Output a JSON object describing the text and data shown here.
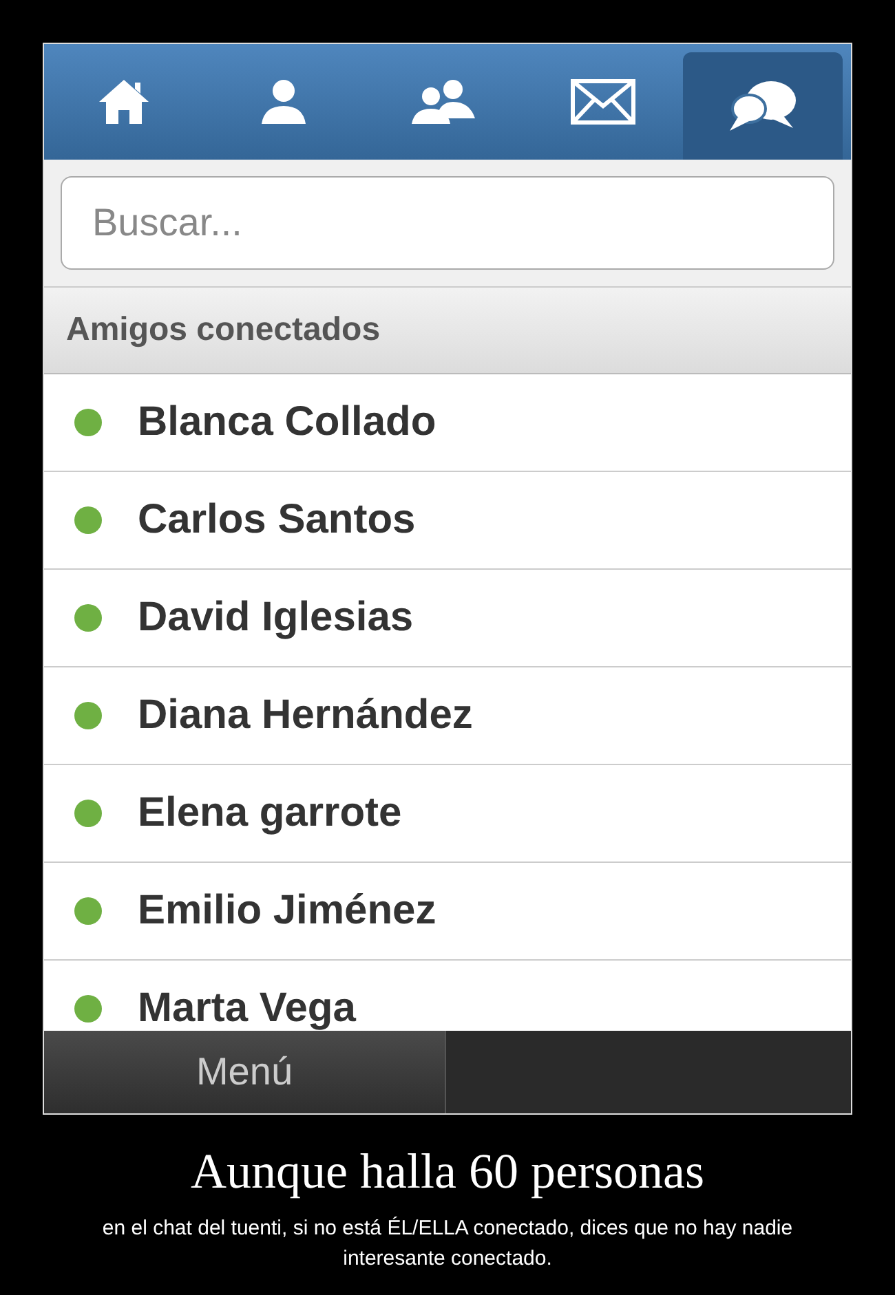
{
  "tabs": [
    {
      "kind": "home",
      "selected": false
    },
    {
      "kind": "person",
      "selected": false
    },
    {
      "kind": "people",
      "selected": false
    },
    {
      "kind": "mail",
      "selected": false
    },
    {
      "kind": "chat",
      "selected": true
    }
  ],
  "search": {
    "placeholder": "Buscar..."
  },
  "section_title": "Amigos conectados",
  "friends": [
    {
      "name": "Blanca Collado",
      "online": true
    },
    {
      "name": "Carlos Santos",
      "online": true
    },
    {
      "name": "David Iglesias",
      "online": true
    },
    {
      "name": "Diana Hernández",
      "online": true
    },
    {
      "name": "Elena garrote",
      "online": true
    },
    {
      "name": "Emilio Jiménez",
      "online": true
    },
    {
      "name": "Marta Vega",
      "online": true
    }
  ],
  "bottom_bar": {
    "menu_button": "Menú"
  },
  "poster": {
    "title": "Aunque halla 60 personas",
    "caption": "en el chat del tuenti, si no está ÉL/ELLA conectado, dices que no hay nadie interesante conectado."
  }
}
